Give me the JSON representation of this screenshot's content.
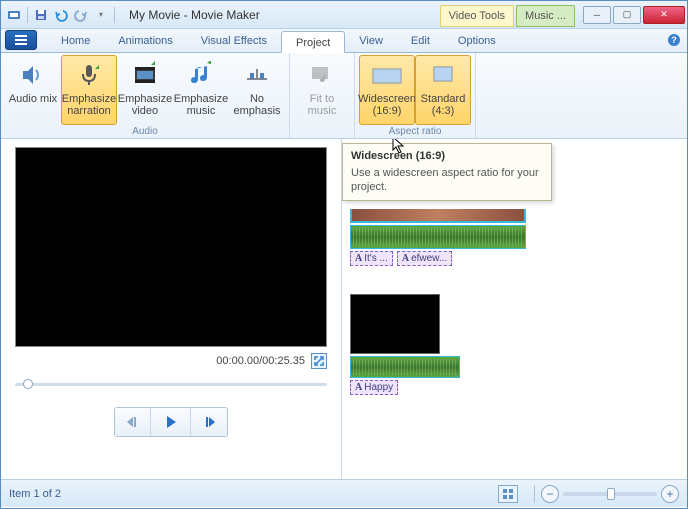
{
  "window": {
    "title": "My Movie - Movie Maker"
  },
  "context_tabs": {
    "video": "Video Tools",
    "music": "Music ..."
  },
  "tabs": {
    "home": "Home",
    "animations": "Animations",
    "visual_effects": "Visual Effects",
    "project": "Project",
    "view": "View",
    "edit": "Edit",
    "options": "Options"
  },
  "ribbon": {
    "audio_group": "Audio",
    "audio_mix": "Audio mix",
    "emphasize_narration": "Emphasize narration",
    "emphasize_video": "Emphasize video",
    "emphasize_music": "Emphasize music",
    "no_emphasis": "No emphasis",
    "fit_to_music": "Fit to music",
    "aspect_group": "Aspect ratio",
    "widescreen": "Widescreen (16:9)",
    "standard": "Standard (4:3)"
  },
  "tooltip": {
    "title": "Widescreen (16:9)",
    "body": "Use a widescreen aspect ratio for your project."
  },
  "preview": {
    "time": "00:00.00/00:25.35"
  },
  "captions": {
    "c1": "It's ...",
    "c2": "efwew...",
    "c3": "Happy"
  },
  "status": {
    "item_count": "Item 1 of 2"
  }
}
